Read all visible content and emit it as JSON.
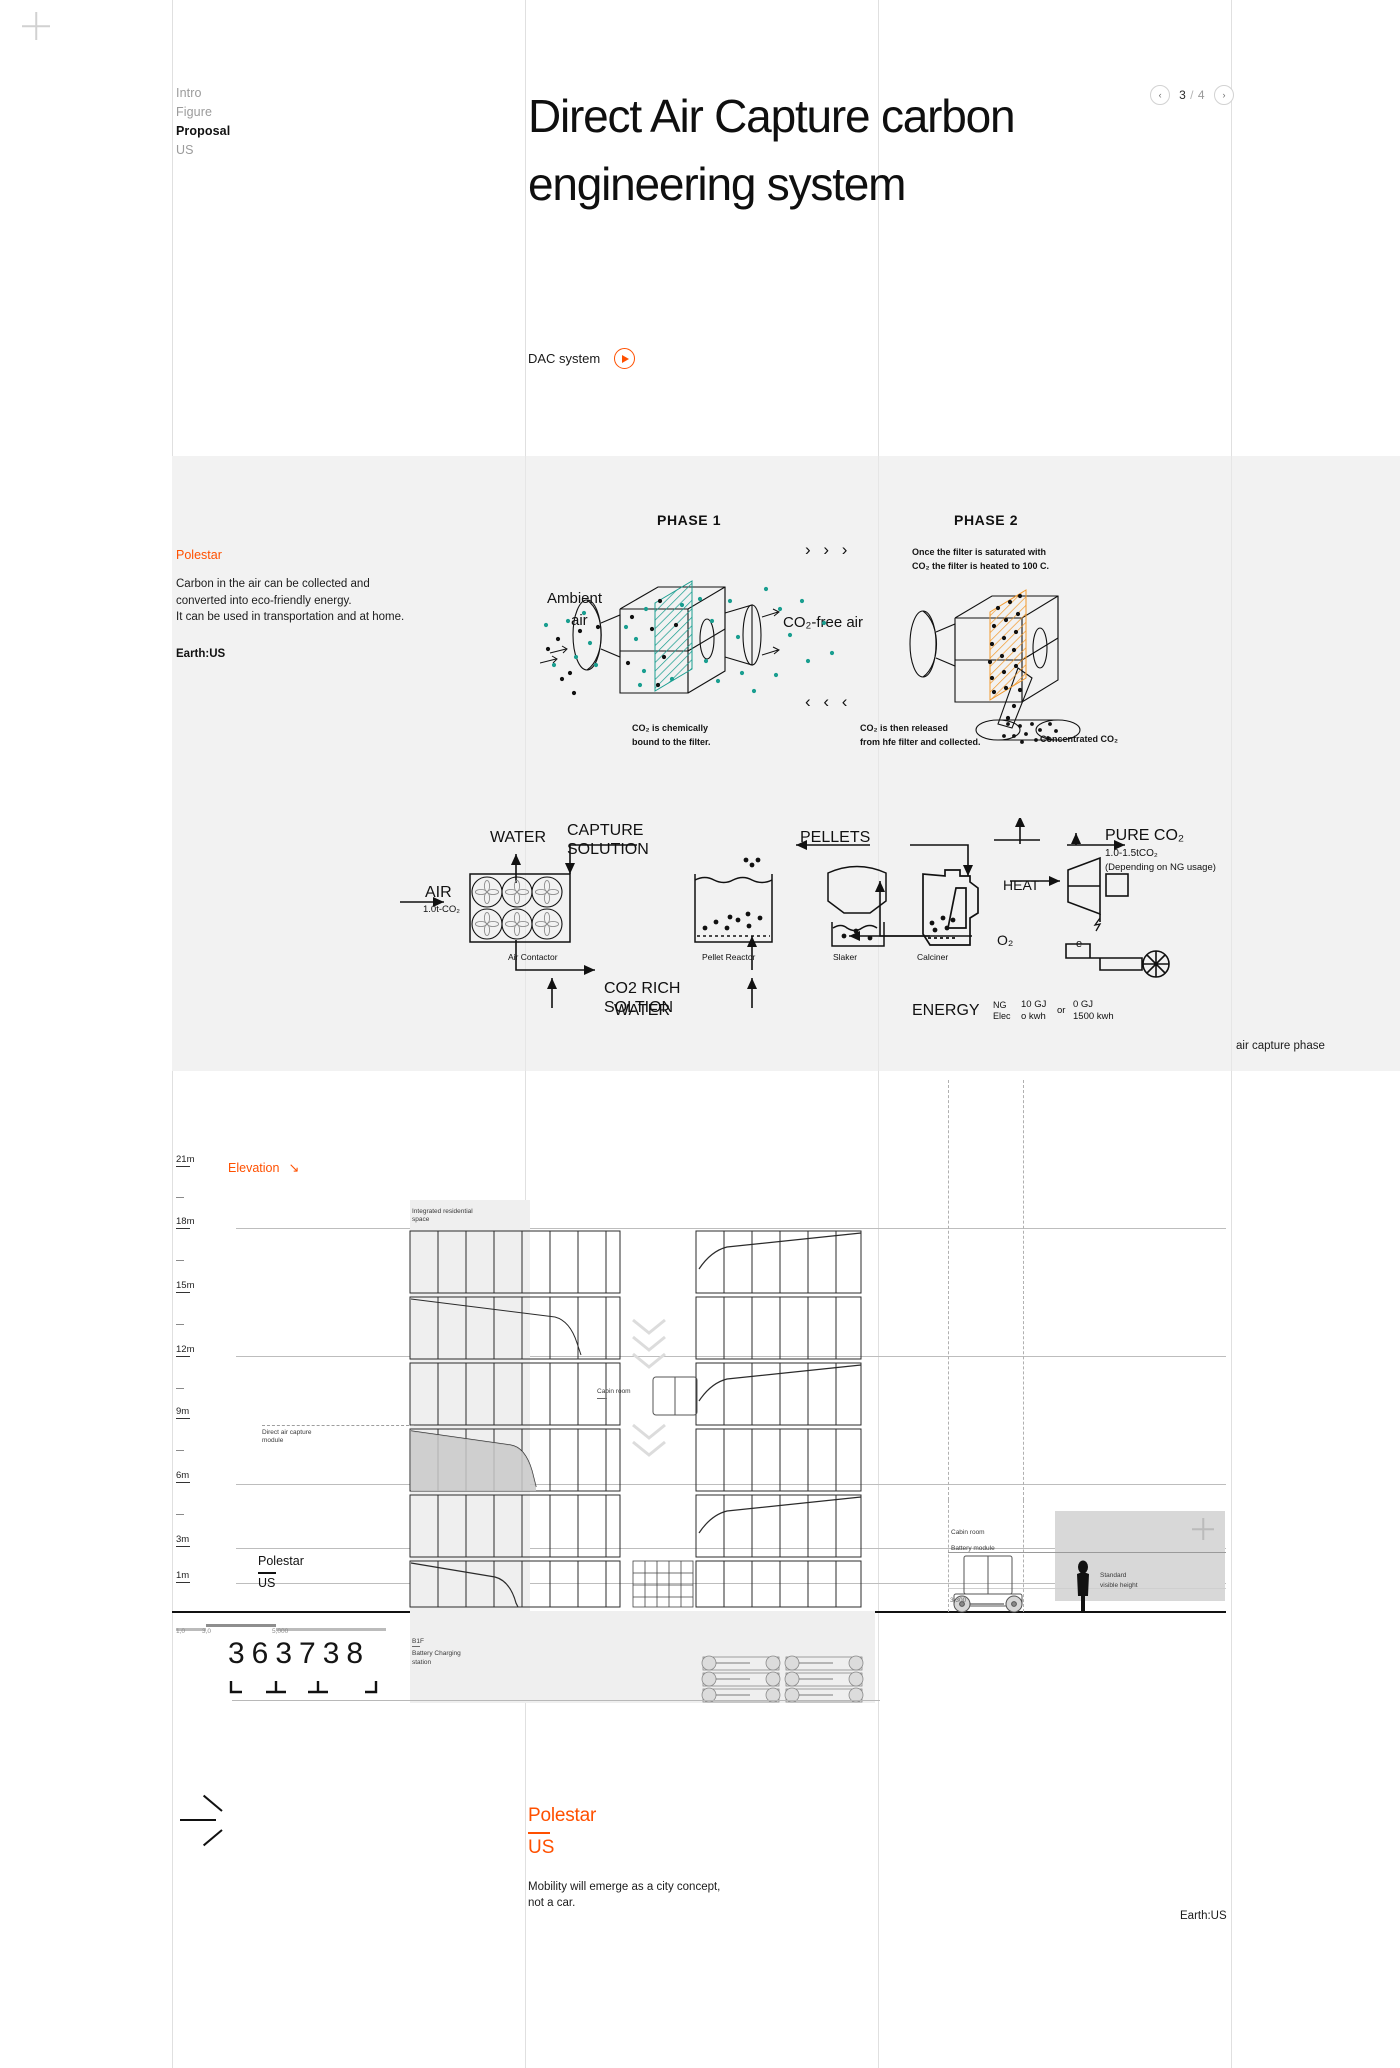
{
  "nav": {
    "items": [
      {
        "label": "Intro",
        "active": false
      },
      {
        "label": "Figure",
        "active": false
      },
      {
        "label": "Proposal",
        "active": true
      },
      {
        "label": "US",
        "active": false
      }
    ]
  },
  "header": {
    "title": "Direct Air Capture carbon engineering system",
    "pager": {
      "prev": "‹",
      "next": "›",
      "current": "3",
      "separator": "/",
      "total": "4"
    },
    "media_label": "DAC system",
    "play_icon": "play-icon"
  },
  "panel": {
    "brand": "Polestar",
    "body": "Carbon in the air can be collected and\nconverted into eco-friendly energy.\nIt can be used in transportation and at home.",
    "body_lines": [
      "Carbon in the air can be collected and",
      "converted into eco-friendly energy.",
      "It can be used in transportation and at home."
    ],
    "earth": "Earth:US",
    "caption_right": "air capture phase"
  },
  "phase1": {
    "title": "PHASE 1",
    "label_in_1": "Ambient",
    "label_in_2": "air",
    "label_out": "CO₂-free air",
    "caption_1": "CO₂ is chemically",
    "caption_2": "bound to the filter.",
    "chev_right": "› › ›",
    "chev_left": "‹ ‹ ‹",
    "filter_color": "#1a9e90"
  },
  "phase2": {
    "title": "PHASE 2",
    "note_1": "Once the filter is saturated with",
    "note_2": "CO₂ the filter is heated to 100 C.",
    "caption_1": "CO₂ is then released",
    "caption_2": "from hfe filter and collected.",
    "label_tank": "Concentrated CO₂",
    "filter_color": "#f29a2e"
  },
  "flow": {
    "air": "AIR",
    "air_sub": "1.0t-CO₂",
    "water_left": "WATER",
    "capture_solution_1": "CAPTURE",
    "capture_solution_2": "SOLUTION",
    "co2rich_1": "CO2 RICH",
    "co2rich_2": "SOLTION",
    "pellets": "PELLETS",
    "pure_co2": "PURE CO₂",
    "pure_co2_sub1": "1.0-1.5tCO₂",
    "pure_co2_sub2": "(Depending on NG usage)",
    "heat": "HEAT",
    "o2": "O₂",
    "e": "e",
    "water_bottom": "WATER",
    "energy": "ENERGY",
    "energy_ng": "NG",
    "energy_elec": "Elec",
    "energy_v1a": "10 GJ",
    "energy_v1b": "o kwh",
    "energy_or": "or",
    "energy_v2a": "0 GJ",
    "energy_v2b": "1500 kwh",
    "box_air_contactor": "Air Contactor",
    "box_pellet_reactor": "Pellet Reactor",
    "box_slaker": "Slaker",
    "box_calciner": "Calciner"
  },
  "elevation": {
    "title": "Elevation",
    "title_arrow": "↘",
    "ticks": [
      "21m",
      "18m",
      "15m",
      "12m",
      "9m",
      "6m",
      "3m",
      "1m"
    ],
    "label_residential_1": "Integrated residential",
    "label_residential_2": "space",
    "label_dac_1": "Direct air capture",
    "label_dac_2": "module",
    "label_cabin": "Cabin room",
    "label_cabin_right_1": "Cabin room",
    "label_cabin_right_2": "Battery module",
    "label_standard_1": "Standard",
    "label_standard_2": "visible height",
    "dim_right": "3,300",
    "brand": "Polestar",
    "brand_sub": "US",
    "b1f_1": "B1F",
    "b1f_2": "Battery Charging",
    "b1f_3": "station",
    "scale_ticks": [
      "1,0",
      "3,0",
      "5,000"
    ],
    "page_numbers": [
      "36",
      "37",
      "38"
    ]
  },
  "footer": {
    "brand": "Polestar",
    "brand_sub": "US",
    "desc_1": "Mobility will emerge as a city concept,",
    "desc_2": "not a car.",
    "earth": "Earth:US",
    "arrow_icon": "arrow-right-icon"
  },
  "colors": {
    "accent": "#ff5000",
    "panel_bg": "#f2f2f2",
    "teal": "#1a9e90",
    "orange_hatch": "#f29a2e"
  }
}
